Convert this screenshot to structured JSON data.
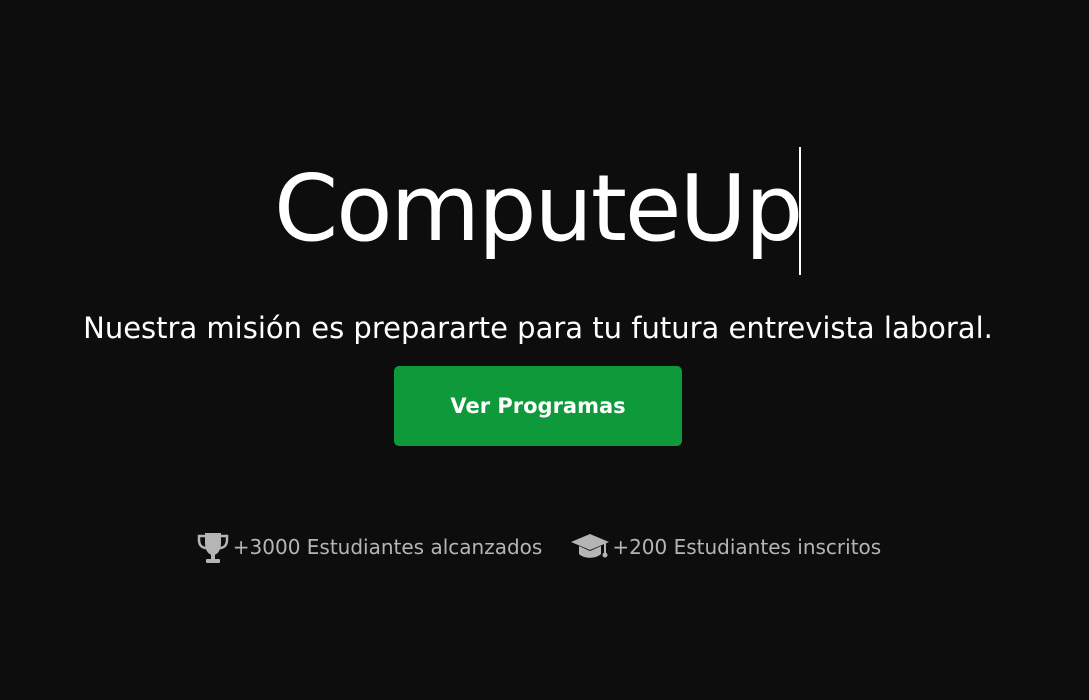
{
  "hero": {
    "brand": "ComputeUp",
    "mission": "Nuestra misión es prepararte para tu futura entrevista laboral.",
    "cta_label": "Ver Programas"
  },
  "stats": [
    {
      "icon": "trophy-icon",
      "text": "+3000 Estudiantes alcanzados"
    },
    {
      "icon": "graduation-cap-icon",
      "text": "+200 Estudiantes inscritos"
    }
  ],
  "colors": {
    "background": "#0d0d0d",
    "primary_text": "#ffffff",
    "stats_text": "#b5b5b5",
    "button": "#0e9a3b"
  }
}
